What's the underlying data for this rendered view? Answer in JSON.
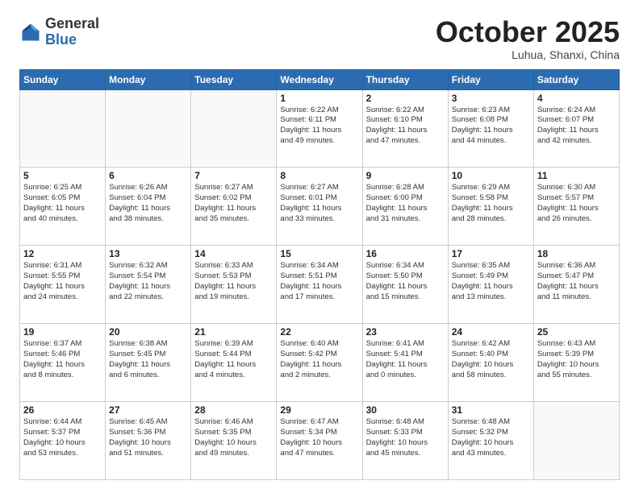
{
  "header": {
    "logo_general": "General",
    "logo_blue": "Blue",
    "month_title": "October 2025",
    "location": "Luhua, Shanxi, China"
  },
  "calendar": {
    "days_of_week": [
      "Sunday",
      "Monday",
      "Tuesday",
      "Wednesday",
      "Thursday",
      "Friday",
      "Saturday"
    ],
    "weeks": [
      [
        {
          "day": "",
          "content": ""
        },
        {
          "day": "",
          "content": ""
        },
        {
          "day": "",
          "content": ""
        },
        {
          "day": "1",
          "content": "Sunrise: 6:22 AM\nSunset: 6:11 PM\nDaylight: 11 hours\nand 49 minutes."
        },
        {
          "day": "2",
          "content": "Sunrise: 6:22 AM\nSunset: 6:10 PM\nDaylight: 11 hours\nand 47 minutes."
        },
        {
          "day": "3",
          "content": "Sunrise: 6:23 AM\nSunset: 6:08 PM\nDaylight: 11 hours\nand 44 minutes."
        },
        {
          "day": "4",
          "content": "Sunrise: 6:24 AM\nSunset: 6:07 PM\nDaylight: 11 hours\nand 42 minutes."
        }
      ],
      [
        {
          "day": "5",
          "content": "Sunrise: 6:25 AM\nSunset: 6:05 PM\nDaylight: 11 hours\nand 40 minutes."
        },
        {
          "day": "6",
          "content": "Sunrise: 6:26 AM\nSunset: 6:04 PM\nDaylight: 11 hours\nand 38 minutes."
        },
        {
          "day": "7",
          "content": "Sunrise: 6:27 AM\nSunset: 6:02 PM\nDaylight: 11 hours\nand 35 minutes."
        },
        {
          "day": "8",
          "content": "Sunrise: 6:27 AM\nSunset: 6:01 PM\nDaylight: 11 hours\nand 33 minutes."
        },
        {
          "day": "9",
          "content": "Sunrise: 6:28 AM\nSunset: 6:00 PM\nDaylight: 11 hours\nand 31 minutes."
        },
        {
          "day": "10",
          "content": "Sunrise: 6:29 AM\nSunset: 5:58 PM\nDaylight: 11 hours\nand 28 minutes."
        },
        {
          "day": "11",
          "content": "Sunrise: 6:30 AM\nSunset: 5:57 PM\nDaylight: 11 hours\nand 26 minutes."
        }
      ],
      [
        {
          "day": "12",
          "content": "Sunrise: 6:31 AM\nSunset: 5:55 PM\nDaylight: 11 hours\nand 24 minutes."
        },
        {
          "day": "13",
          "content": "Sunrise: 6:32 AM\nSunset: 5:54 PM\nDaylight: 11 hours\nand 22 minutes."
        },
        {
          "day": "14",
          "content": "Sunrise: 6:33 AM\nSunset: 5:53 PM\nDaylight: 11 hours\nand 19 minutes."
        },
        {
          "day": "15",
          "content": "Sunrise: 6:34 AM\nSunset: 5:51 PM\nDaylight: 11 hours\nand 17 minutes."
        },
        {
          "day": "16",
          "content": "Sunrise: 6:34 AM\nSunset: 5:50 PM\nDaylight: 11 hours\nand 15 minutes."
        },
        {
          "day": "17",
          "content": "Sunrise: 6:35 AM\nSunset: 5:49 PM\nDaylight: 11 hours\nand 13 minutes."
        },
        {
          "day": "18",
          "content": "Sunrise: 6:36 AM\nSunset: 5:47 PM\nDaylight: 11 hours\nand 11 minutes."
        }
      ],
      [
        {
          "day": "19",
          "content": "Sunrise: 6:37 AM\nSunset: 5:46 PM\nDaylight: 11 hours\nand 8 minutes."
        },
        {
          "day": "20",
          "content": "Sunrise: 6:38 AM\nSunset: 5:45 PM\nDaylight: 11 hours\nand 6 minutes."
        },
        {
          "day": "21",
          "content": "Sunrise: 6:39 AM\nSunset: 5:44 PM\nDaylight: 11 hours\nand 4 minutes."
        },
        {
          "day": "22",
          "content": "Sunrise: 6:40 AM\nSunset: 5:42 PM\nDaylight: 11 hours\nand 2 minutes."
        },
        {
          "day": "23",
          "content": "Sunrise: 6:41 AM\nSunset: 5:41 PM\nDaylight: 11 hours\nand 0 minutes."
        },
        {
          "day": "24",
          "content": "Sunrise: 6:42 AM\nSunset: 5:40 PM\nDaylight: 10 hours\nand 58 minutes."
        },
        {
          "day": "25",
          "content": "Sunrise: 6:43 AM\nSunset: 5:39 PM\nDaylight: 10 hours\nand 55 minutes."
        }
      ],
      [
        {
          "day": "26",
          "content": "Sunrise: 6:44 AM\nSunset: 5:37 PM\nDaylight: 10 hours\nand 53 minutes."
        },
        {
          "day": "27",
          "content": "Sunrise: 6:45 AM\nSunset: 5:36 PM\nDaylight: 10 hours\nand 51 minutes."
        },
        {
          "day": "28",
          "content": "Sunrise: 6:46 AM\nSunset: 5:35 PM\nDaylight: 10 hours\nand 49 minutes."
        },
        {
          "day": "29",
          "content": "Sunrise: 6:47 AM\nSunset: 5:34 PM\nDaylight: 10 hours\nand 47 minutes."
        },
        {
          "day": "30",
          "content": "Sunrise: 6:48 AM\nSunset: 5:33 PM\nDaylight: 10 hours\nand 45 minutes."
        },
        {
          "day": "31",
          "content": "Sunrise: 6:48 AM\nSunset: 5:32 PM\nDaylight: 10 hours\nand 43 minutes."
        },
        {
          "day": "",
          "content": ""
        }
      ]
    ]
  }
}
